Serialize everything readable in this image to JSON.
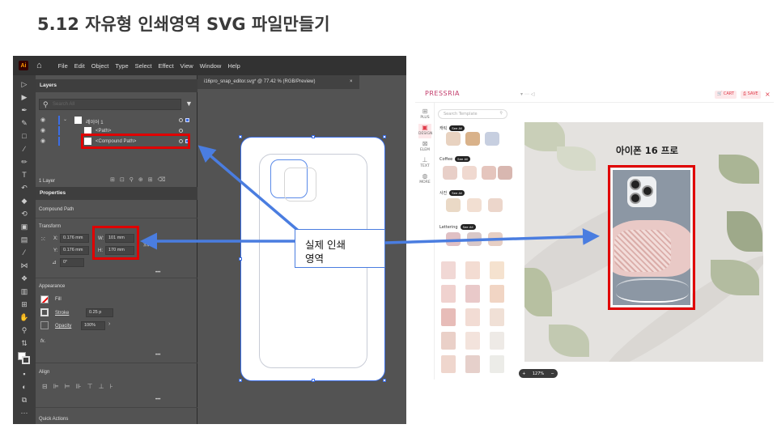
{
  "slide": {
    "title": "5.12 자유형 인쇄영역 SVG 파일만들기"
  },
  "illustrator": {
    "logo": "Ai",
    "menu": [
      "File",
      "Edit",
      "Object",
      "Type",
      "Select",
      "Effect",
      "View",
      "Window",
      "Help"
    ],
    "doc_tab": "i16pro_snap_editor.svg* @ 77.42 % (RGB/Preview)",
    "doc_close": "×",
    "layers_header": "Layers",
    "search_placeholder": "Search All",
    "layer_group": "레이어 1",
    "layer_path": "<Path>",
    "layer_compound": "<Compound Path>",
    "layer_count": "1 Layer",
    "properties_header": "Properties",
    "selection_type": "Compound Path",
    "transform_label": "Transform",
    "x_label": "X:",
    "x_value": "0.176 mm",
    "y_label": "Y:",
    "y_value": "0.176 mm",
    "w_label": "W:",
    "w_value": "101 mm",
    "h_label": "H:",
    "h_value": "170 mm",
    "angle_value": "0°",
    "appearance_label": "Appearance",
    "fill_label": "Fill",
    "stroke_label": "Stroke",
    "stroke_value": "0.25 p",
    "opacity_label": "Opacity",
    "opacity_value": "100%",
    "fx_label": "fx.",
    "align_label": "Align",
    "quick_actions_label": "Quick Actions",
    "more_dots": "•••"
  },
  "pressria": {
    "logo": "PRESSRIA",
    "cart_label": "CART",
    "save_label": "SAVE",
    "close": "×",
    "search_placeholder": "Search Template",
    "categories": [
      "캐릭",
      "Coffee",
      "사진",
      "Lettering"
    ],
    "see_all": "See All",
    "nav_items": [
      "PLUS",
      "DESIGN",
      "ELEM",
      "TEXT",
      "MORE"
    ],
    "product_title": "아이폰 16 프로",
    "zoom_minus": "−",
    "zoom_value": "127%",
    "zoom_plus": "+"
  },
  "callout": {
    "line1": "실제 인쇄",
    "line2": "영역"
  },
  "colors": {
    "highlight": "#e00000",
    "arrow": "#4a7de0",
    "brand": "#c23b6a"
  }
}
